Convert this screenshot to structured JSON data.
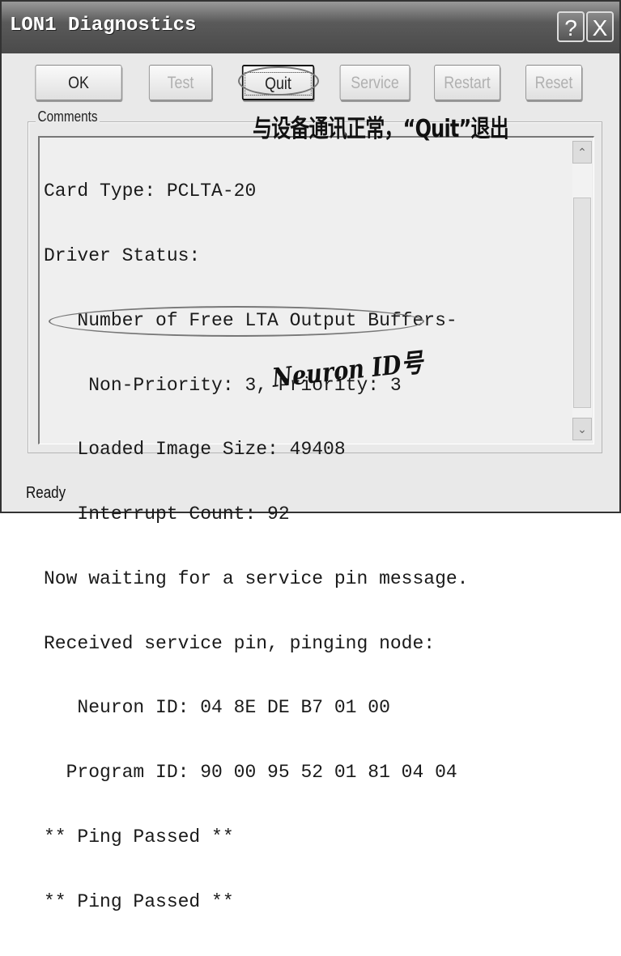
{
  "window": {
    "title": "LON1 Diagnostics",
    "help_label": "?",
    "close_label": "X"
  },
  "buttons": [
    {
      "label": "OK",
      "enabled": true
    },
    {
      "label": "Test",
      "enabled": false
    },
    {
      "label": "Quit",
      "enabled": true,
      "default": true
    },
    {
      "label": "Service",
      "enabled": false
    },
    {
      "label": "Restart",
      "enabled": false
    },
    {
      "label": "Reset",
      "enabled": false
    }
  ],
  "comments": {
    "label": "Comments",
    "lines": [
      "Card Type: PCLTA-20",
      "Driver Status:",
      "   Number of Free LTA Output Buffers-",
      "    Non-Priority: 3, Priority: 3",
      "   Loaded Image Size: 49408",
      "   Interrupt Count: 92",
      "Now waiting for a service pin message.",
      "Received service pin, pinging node:",
      "   Neuron ID: 04 8E DE B7 01 00",
      "  Program ID: 90 00 95 52 01 81 04 04",
      "** Ping Passed **",
      "** Ping Passed **"
    ]
  },
  "annotations": {
    "quit_note": "与设备通讯正常，“Quit”退出",
    "neuron_note": "Neuron ID号"
  },
  "status": "Ready"
}
